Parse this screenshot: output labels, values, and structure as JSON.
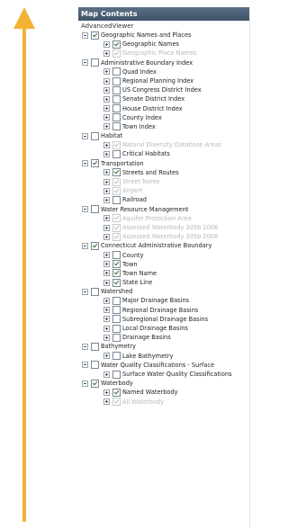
{
  "panel": {
    "title": "Map Contents",
    "root": "AdvancedViewer"
  },
  "colors": {
    "arrow": "#f3b234",
    "header": "#4a5e76"
  },
  "layers": [
    {
      "label": "Geographic Names and Places",
      "level": 0,
      "checked": true,
      "expander": "minus",
      "disabled": false
    },
    {
      "label": "Geographic Names",
      "level": 1,
      "checked": true,
      "expander": "plus",
      "disabled": false
    },
    {
      "label": "Geographic Place Names",
      "level": 1,
      "checked": true,
      "expander": "plus",
      "disabled": true
    },
    {
      "label": "Administrative Boundary Index",
      "level": 0,
      "checked": false,
      "expander": "minus",
      "disabled": false
    },
    {
      "label": "Quad Index",
      "level": 1,
      "checked": false,
      "expander": "plus",
      "disabled": false
    },
    {
      "label": "Regional Planning Index",
      "level": 1,
      "checked": false,
      "expander": "plus",
      "disabled": false
    },
    {
      "label": "US Congress District Index",
      "level": 1,
      "checked": false,
      "expander": "plus",
      "disabled": false
    },
    {
      "label": "Senate District Index",
      "level": 1,
      "checked": false,
      "expander": "plus",
      "disabled": false
    },
    {
      "label": "House District Index",
      "level": 1,
      "checked": false,
      "expander": "plus",
      "disabled": false
    },
    {
      "label": "County Index",
      "level": 1,
      "checked": false,
      "expander": "plus",
      "disabled": false
    },
    {
      "label": "Town Index",
      "level": 1,
      "checked": false,
      "expander": "plus",
      "disabled": false
    },
    {
      "label": "Habitat",
      "level": 0,
      "checked": false,
      "expander": "minus",
      "disabled": false
    },
    {
      "label": "Natural Diversity Database Areas",
      "level": 1,
      "checked": true,
      "expander": "plus",
      "disabled": true
    },
    {
      "label": "Critical Habitats",
      "level": 1,
      "checked": false,
      "expander": "plus",
      "disabled": false
    },
    {
      "label": "Transportation",
      "level": 0,
      "checked": true,
      "expander": "minus",
      "disabled": false
    },
    {
      "label": "Streets and Routes",
      "level": 1,
      "checked": true,
      "expander": "plus",
      "disabled": false
    },
    {
      "label": "Street Name",
      "level": 1,
      "checked": true,
      "expander": "plus",
      "disabled": true
    },
    {
      "label": "Airport",
      "level": 1,
      "checked": true,
      "expander": "plus",
      "disabled": true
    },
    {
      "label": "Railroad",
      "level": 1,
      "checked": false,
      "expander": "plus",
      "disabled": false
    },
    {
      "label": "Water Resource Management",
      "level": 0,
      "checked": false,
      "expander": "minus",
      "disabled": false
    },
    {
      "label": "Aquifer Protection Area",
      "level": 1,
      "checked": true,
      "expander": "plus",
      "disabled": true
    },
    {
      "label": "Assessed Waterbody 305b 2006",
      "level": 1,
      "checked": true,
      "expander": "plus",
      "disabled": true
    },
    {
      "label": "Assessed Waterbody 305b 2008",
      "level": 1,
      "checked": true,
      "expander": "plus",
      "disabled": true
    },
    {
      "label": "Connecticut Administrative Boundary",
      "level": 0,
      "checked": true,
      "expander": "minus",
      "disabled": false
    },
    {
      "label": "County",
      "level": 1,
      "checked": false,
      "expander": "plus",
      "disabled": false
    },
    {
      "label": "Town",
      "level": 1,
      "checked": true,
      "expander": "plus",
      "disabled": false
    },
    {
      "label": "Town Name",
      "level": 1,
      "checked": true,
      "expander": "plus",
      "disabled": false
    },
    {
      "label": "State Line",
      "level": 1,
      "checked": true,
      "expander": "plus",
      "disabled": false
    },
    {
      "label": "Watershed",
      "level": 0,
      "checked": false,
      "expander": "minus",
      "disabled": false
    },
    {
      "label": "Major Drainage Basins",
      "level": 1,
      "checked": false,
      "expander": "plus",
      "disabled": false
    },
    {
      "label": "Regional Drainage Basins",
      "level": 1,
      "checked": false,
      "expander": "plus",
      "disabled": false
    },
    {
      "label": "Subregional Drainage Basins",
      "level": 1,
      "checked": false,
      "expander": "plus",
      "disabled": false
    },
    {
      "label": "Local Drainage Basins",
      "level": 1,
      "checked": false,
      "expander": "plus",
      "disabled": false
    },
    {
      "label": "Drainage Basins",
      "level": 1,
      "checked": false,
      "expander": "plus",
      "disabled": false
    },
    {
      "label": "Bathymetry",
      "level": 0,
      "checked": false,
      "expander": "minus",
      "disabled": false
    },
    {
      "label": "Lake Bathymetry",
      "level": 1,
      "checked": false,
      "expander": "plus",
      "disabled": false
    },
    {
      "label": "Water Quality Classifications - Surface",
      "level": 0,
      "checked": false,
      "expander": "minus",
      "disabled": false
    },
    {
      "label": "Surface Water Quality Classifications",
      "level": 1,
      "checked": false,
      "expander": "plus",
      "disabled": false
    },
    {
      "label": "Waterbody",
      "level": 0,
      "checked": true,
      "expander": "minus",
      "disabled": false
    },
    {
      "label": "Named Waterbody",
      "level": 1,
      "checked": true,
      "expander": "plus",
      "disabled": false
    },
    {
      "label": "All Waterbody",
      "level": 1,
      "checked": true,
      "expander": "plus",
      "disabled": true
    }
  ]
}
